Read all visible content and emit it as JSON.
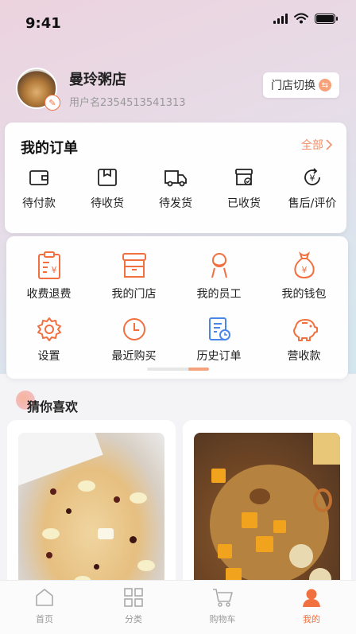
{
  "status_bar": {
    "time": "9:41"
  },
  "profile": {
    "shop_name": "曼玲粥店",
    "user_name": "用户名2354513541313",
    "switch_label": "门店切换"
  },
  "orders": {
    "title": "我的订单",
    "all_label": "全部",
    "items": [
      {
        "label": "待付款",
        "icon": "wallet-icon"
      },
      {
        "label": "待收货",
        "icon": "package-icon"
      },
      {
        "label": "待发货",
        "icon": "truck-icon"
      },
      {
        "label": "已收货",
        "icon": "received-box-icon"
      },
      {
        "label": "售后/评价",
        "icon": "yen-refresh-icon"
      }
    ]
  },
  "tools": {
    "items": [
      {
        "label": "收费退费",
        "icon": "clipboard-yen-icon"
      },
      {
        "label": "我的门店",
        "icon": "store-icon"
      },
      {
        "label": "我的员工",
        "icon": "staff-icon"
      },
      {
        "label": "我的钱包",
        "icon": "money-bag-icon"
      },
      {
        "label": "设置",
        "icon": "gear-icon"
      },
      {
        "label": "最近购买",
        "icon": "clock-icon"
      },
      {
        "label": "历史订单",
        "icon": "history-order-icon"
      },
      {
        "label": "营收款",
        "icon": "piggy-bank-icon"
      }
    ]
  },
  "recommend": {
    "title": "猜你喜欢"
  },
  "tab_bar": {
    "tabs": [
      {
        "label": "首页",
        "icon": "home-icon",
        "active": false
      },
      {
        "label": "分类",
        "icon": "grid-icon",
        "active": false
      },
      {
        "label": "购物车",
        "icon": "cart-icon",
        "active": false
      },
      {
        "label": "我的",
        "icon": "user-icon",
        "active": true
      }
    ]
  },
  "colors": {
    "accent": "#f07040",
    "accent_light": "#f2906a",
    "blue": "#4a86e8"
  }
}
